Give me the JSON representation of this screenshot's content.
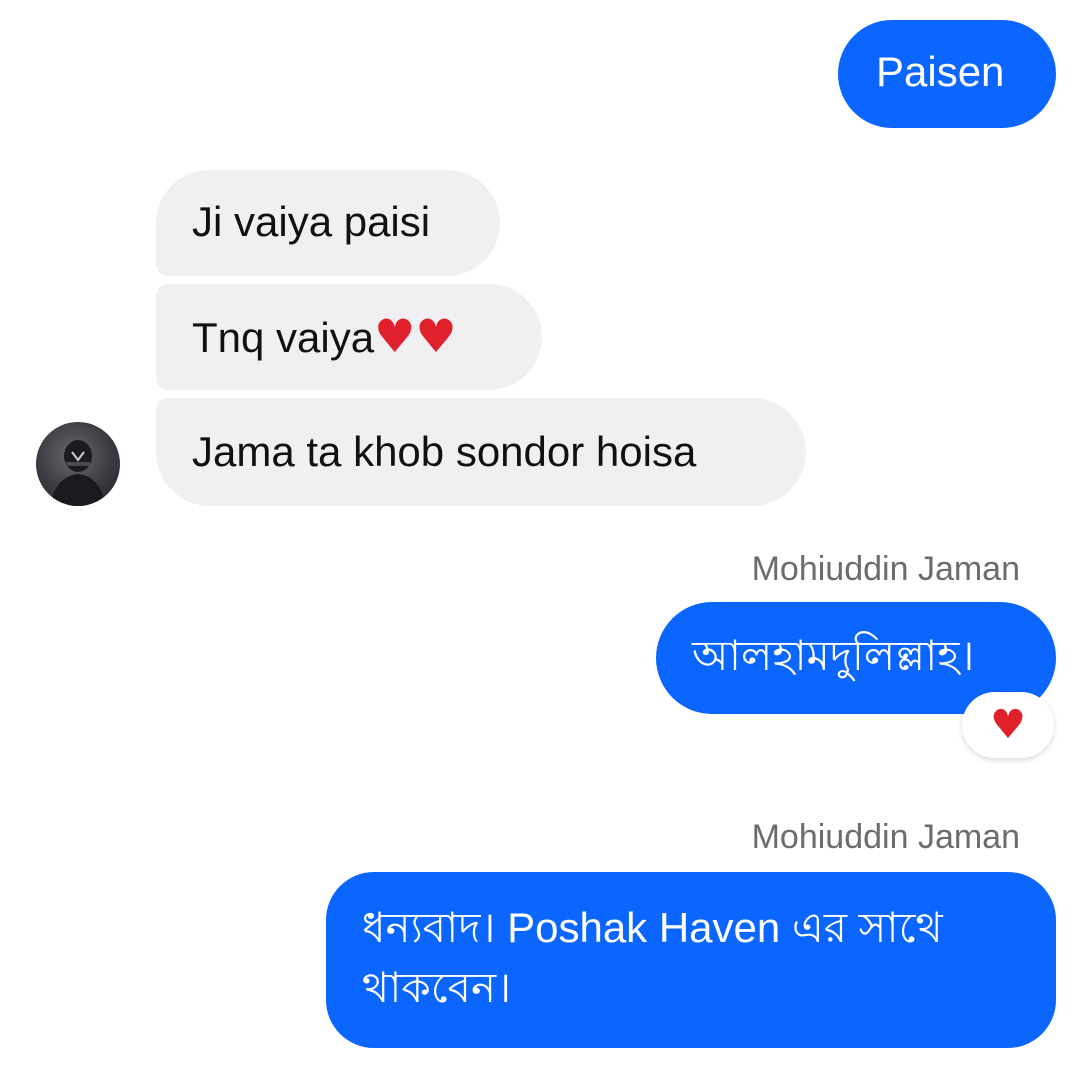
{
  "messages": {
    "m1": {
      "text": "Paisen"
    },
    "m2": {
      "text": "Ji vaiya paisi"
    },
    "m3": {
      "text": "Tnq vaiya",
      "emoji": "♥♥"
    },
    "m4": {
      "text": "Jama ta khob sondor hoisa"
    },
    "m5": {
      "sender": "Mohiuddin Jaman",
      "text": "আলহামদুলিল্লাহ।",
      "reaction": "♥"
    },
    "m6": {
      "sender": "Mohiuddin Jaman",
      "line1": "ধন্যবাদ। Poshak Haven এর সাথে",
      "line2": "থাকবেন।"
    }
  },
  "colors": {
    "outgoing_bubble": "#0a66ff",
    "incoming_bubble": "#f0f0f3",
    "heart": "#e0202a"
  },
  "icons": {
    "avatar": "profile-photo",
    "reaction": "red-heart"
  }
}
